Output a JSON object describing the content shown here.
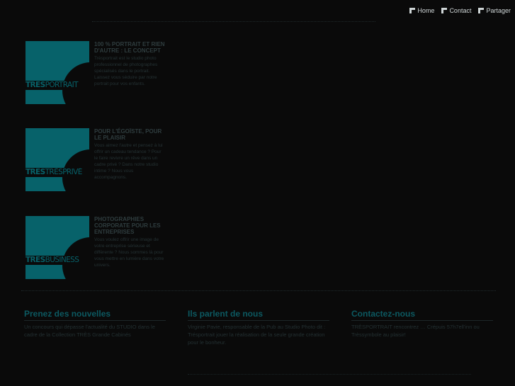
{
  "nav": {
    "items": [
      {
        "label": "Home",
        "icon": "corner-icon"
      },
      {
        "label": "Contact",
        "icon": "corner-icon"
      },
      {
        "label": "Partager",
        "icon": "corner-icon"
      }
    ]
  },
  "products": [
    {
      "logo_word1": "TRES",
      "logo_word2": "PORTRAIT",
      "title": "100 % portrait et rien d'autre : le concept",
      "desc": "Trèsportrait est le studio photo professionnel de photographes spécialisés dans le portrait. Laissez vous séduire par notre portrait pour vos enfants."
    },
    {
      "logo_word1": "TRES",
      "logo_word2": "TRÈSPRIVÉ",
      "title": "Pour l'égoïste, pour le plaisir",
      "desc": "Vous aimez l'autre et pensez à lui offrir un cadeau tendance ? Pour le faire revivre un rêve dans un cadre privé ? Dans notre studio intime ? Nous vous accompagnons."
    },
    {
      "logo_word1": "TRES",
      "logo_word2": "BUSINESS",
      "title": "Photographies corporate pour les entreprises",
      "desc": "Vous voulez offrir une image de votre entreprise sérieuse et différente ? Nous sommes là pour vous mettre en lumière dans votre univers."
    }
  ],
  "columns": [
    {
      "title": "Prenez des nouvelles",
      "text": "Un concours qui dépasse l'actualité du STUDIO dans le cadre de la Collection TRÈS Grande Cabinés"
    },
    {
      "title": "Ils parlent de nous",
      "text": "Virginie Pavie, responsable de la Pub au Studio Photo dit : Trésportrait jouer la réalisation de la seule grande création pour le bonheur."
    },
    {
      "title": "Contactez-nous",
      "text": "TRÈSPORTRAIT rencontrez … Crépuis 57h7ell'inn ou Trèssymbole au plaisir!"
    }
  ],
  "colors": {
    "background": "#0a0a0a",
    "accent": "#07626a",
    "heading": "#0c5961",
    "nav_text": "#cfd6d7"
  }
}
